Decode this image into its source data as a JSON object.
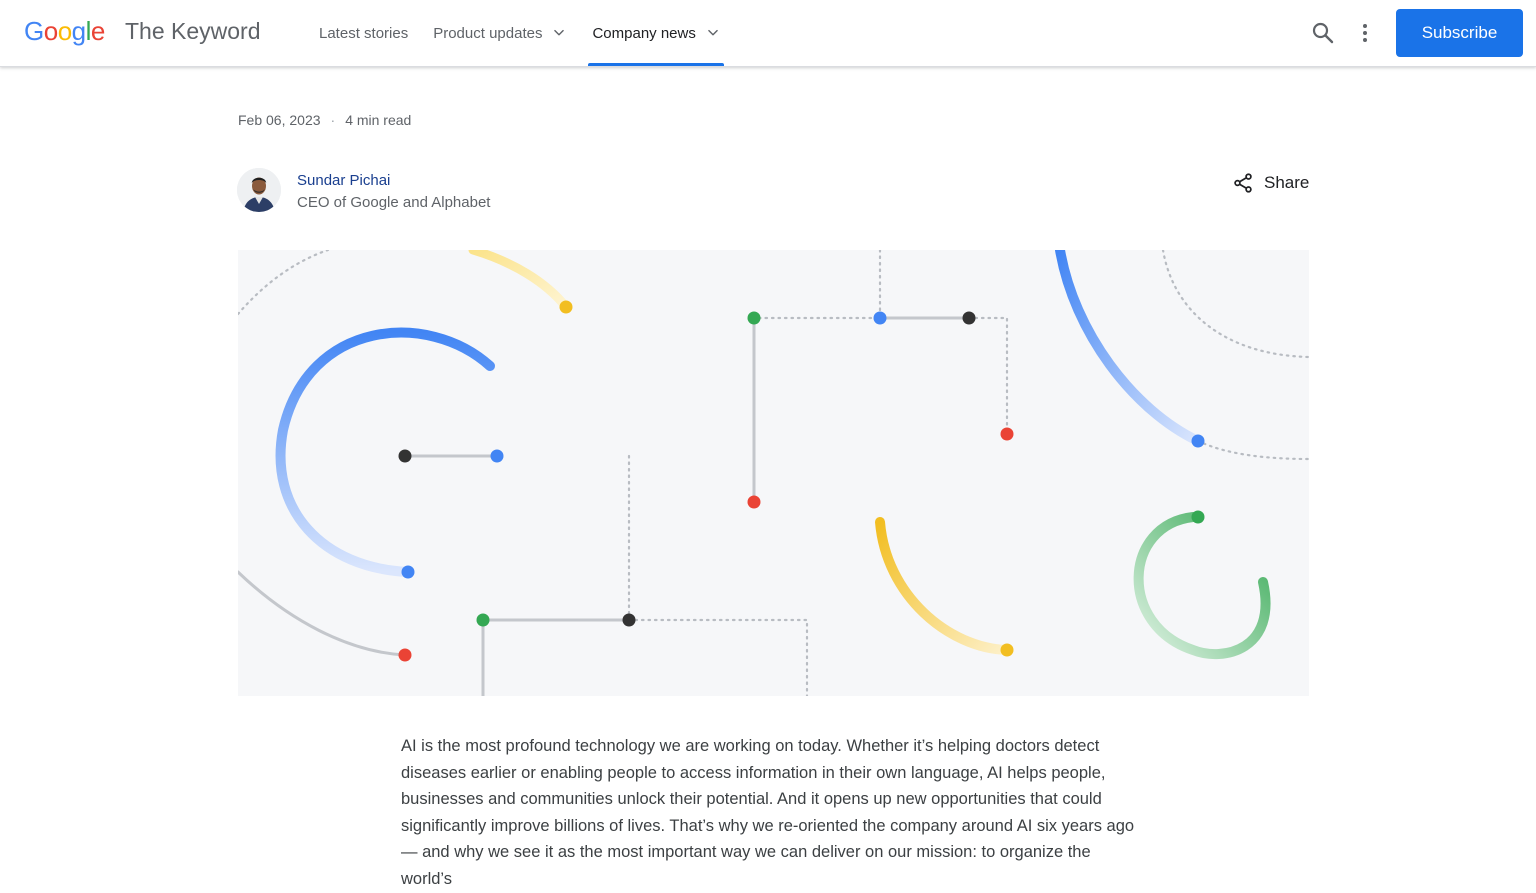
{
  "header": {
    "logo_letters": [
      {
        "char": "G",
        "color": "#4285F4"
      },
      {
        "char": "o",
        "color": "#EA4335"
      },
      {
        "char": "o",
        "color": "#FBBC05"
      },
      {
        "char": "g",
        "color": "#4285F4"
      },
      {
        "char": "l",
        "color": "#34A853"
      },
      {
        "char": "e",
        "color": "#EA4335"
      }
    ],
    "site_title": "The Keyword",
    "nav": [
      {
        "label": "Latest stories",
        "has_dropdown": false,
        "active": false
      },
      {
        "label": "Product updates",
        "has_dropdown": true,
        "active": false
      },
      {
        "label": "Company news",
        "has_dropdown": true,
        "active": true
      }
    ],
    "search_icon": "search-icon",
    "more_icon": "more-vert-icon",
    "subscribe_label": "Subscribe"
  },
  "article": {
    "date": "Feb 06, 2023",
    "separator": "·",
    "read_time": "4 min read",
    "author_name": "Sundar Pichai",
    "author_role": "CEO of Google and Alphabet",
    "share_label": "Share",
    "body": "AI is the most profound technology we are working on today. Whether it’s helping doctors detect diseases earlier or enabling people to access information in their own language, AI helps people, businesses and communities unlock their potential. And it opens up new opportunities that could significantly improve billions of lives. That’s why we re-oriented the company around AI six years ago — and why we see it as the most important way we can deliver on our mission: to organize the world’s"
  },
  "colors": {
    "accent": "#1a73e8",
    "blue": "#4285F4",
    "red": "#EA4335",
    "yellow": "#FBBC05",
    "green": "#34A853"
  }
}
